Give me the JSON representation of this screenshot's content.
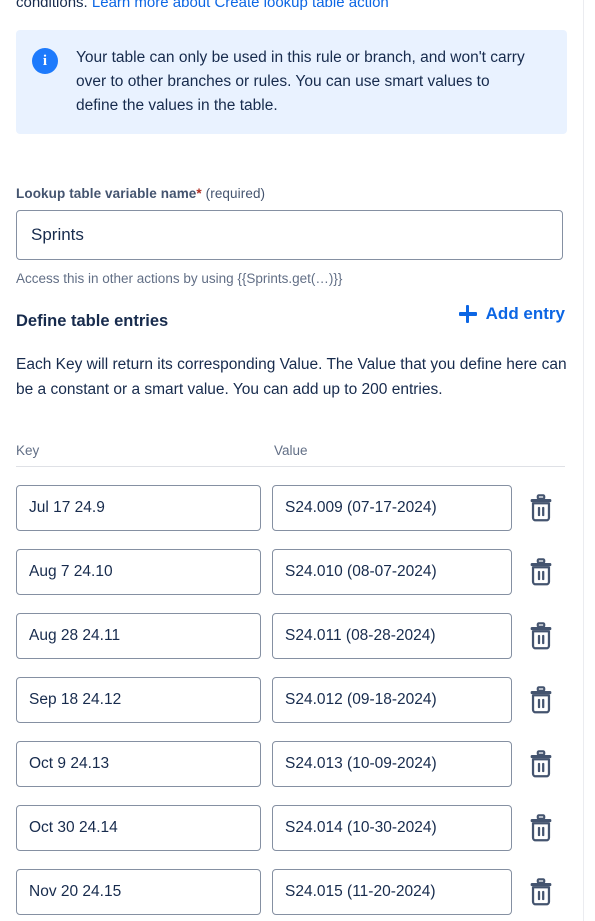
{
  "top_clipped": {
    "prefix": "conditions. ",
    "link": "Learn more about Create lookup table action"
  },
  "info_banner": {
    "icon": "info-icon",
    "text": "Your table can only be used in this rule or branch, and won't carry over to other branches or rules. You can use smart values to define the values in the table."
  },
  "variable_field": {
    "label": "Lookup table variable name",
    "required_star": "*",
    "required_word": "(required)",
    "value": "Sprints",
    "placeholder": "",
    "helper": "Access this in other actions by using {{Sprints.get(…)}}"
  },
  "entries_section": {
    "heading": "Define table entries",
    "add_entry_label": "Add entry",
    "add_entry_icon": "plus-icon",
    "description": "Each Key will return its corresponding Value. The Value that you define here can be a constant or a smart value. You can add up to 200 entries.",
    "columns": [
      "Key",
      "Value"
    ],
    "delete_icon": "trash-icon",
    "rows": [
      {
        "key": "Jul 17 24.9",
        "value": "S24.009 (07-17-2024)"
      },
      {
        "key": "Aug 7 24.10",
        "value": "S24.010 (08-07-2024)"
      },
      {
        "key": "Aug 28 24.11",
        "value": "S24.011 (08-28-2024)"
      },
      {
        "key": "Sep 18 24.12",
        "value": "S24.012 (09-18-2024)"
      },
      {
        "key": "Oct 9 24.13",
        "value": "S24.013 (10-09-2024)"
      },
      {
        "key": "Oct 30 24.14",
        "value": "S24.014 (10-30-2024)"
      },
      {
        "key": "Nov 20 24.15",
        "value": "S24.015 (11-20-2024)"
      }
    ]
  },
  "colors": {
    "link": "#0c66e4",
    "info_bg": "#e9f2ff",
    "info_icon": "#1d7afc",
    "text": "#172b4d",
    "subtle_text": "#626f86",
    "label": "#44546f",
    "required": "#ae2e24",
    "border": "#8590a2",
    "divider": "#dfe1e6",
    "trash": "#44546f"
  }
}
